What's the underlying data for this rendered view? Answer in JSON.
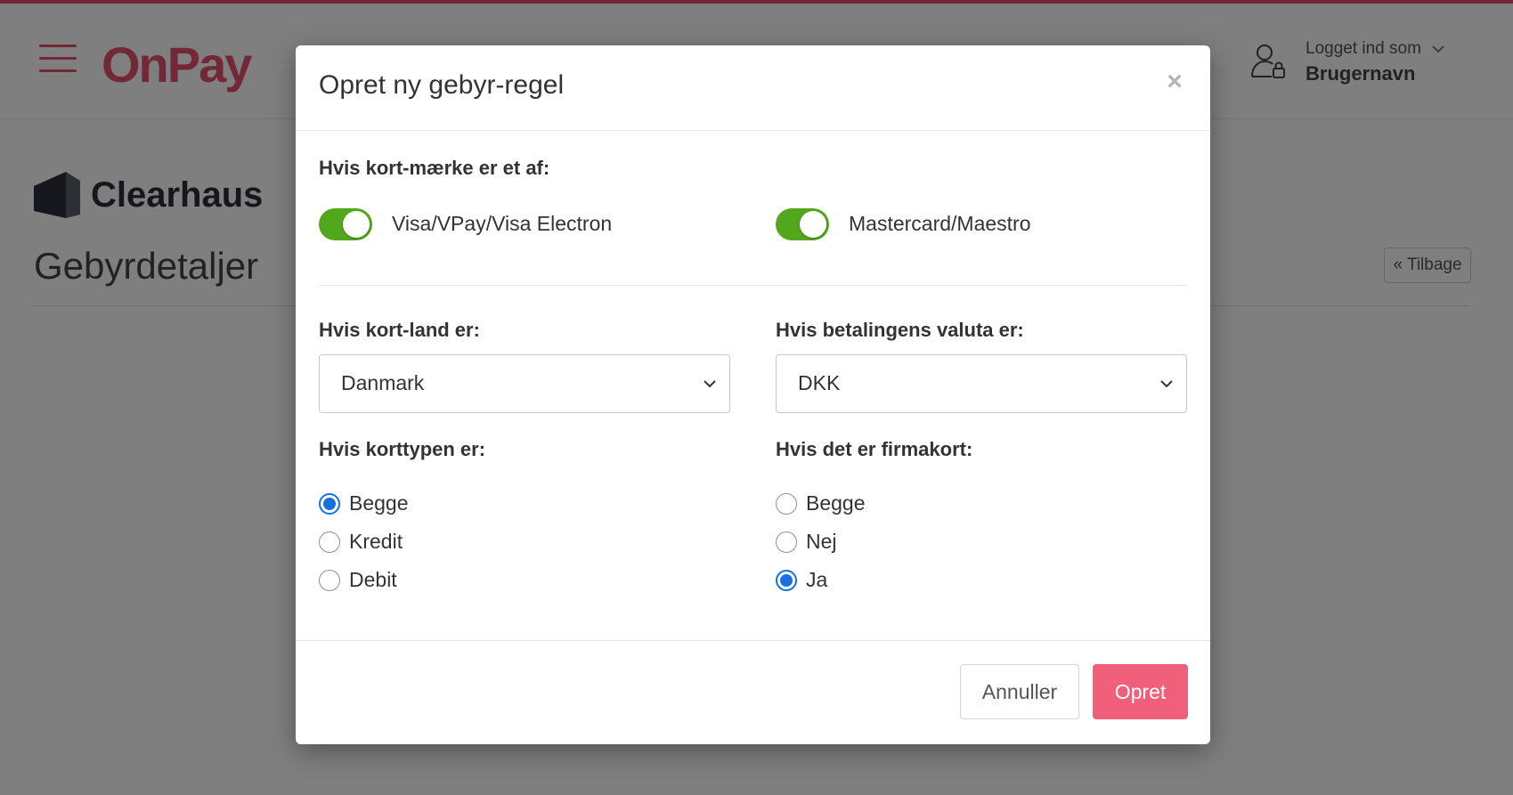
{
  "header": {
    "logo_text": "OnPay",
    "user_label": "Logget ind som",
    "user_name": "Brugernavn"
  },
  "page": {
    "brand_name": "Clearhaus",
    "title": "Gebyrdetaljer",
    "back_label": "« Tilbage"
  },
  "modal": {
    "title": "Opret ny gebyr-regel",
    "close_label": "×",
    "card_brand_label": "Hvis kort-mærke er et af:",
    "toggles": [
      {
        "label": "Visa/VPay/Visa Electron",
        "on": true
      },
      {
        "label": "Mastercard/Maestro",
        "on": true
      }
    ],
    "country_label": "Hvis kort-land er:",
    "country_value": "Danmark",
    "currency_label": "Hvis betalingens valuta er:",
    "currency_value": "DKK",
    "card_type_label": "Hvis korttypen er:",
    "card_type_options": [
      {
        "label": "Begge",
        "checked": true
      },
      {
        "label": "Kredit",
        "checked": false
      },
      {
        "label": "Debit",
        "checked": false
      }
    ],
    "corporate_label": "Hvis det er firmakort:",
    "corporate_options": [
      {
        "label": "Begge",
        "checked": false
      },
      {
        "label": "Nej",
        "checked": false
      },
      {
        "label": "Ja",
        "checked": true
      }
    ],
    "cancel_label": "Annuller",
    "create_label": "Opret"
  },
  "colors": {
    "brand": "#e4506e",
    "toggle_on": "#52a71d",
    "radio_checked": "#1a6fe0",
    "primary_button": "#f0607a"
  }
}
